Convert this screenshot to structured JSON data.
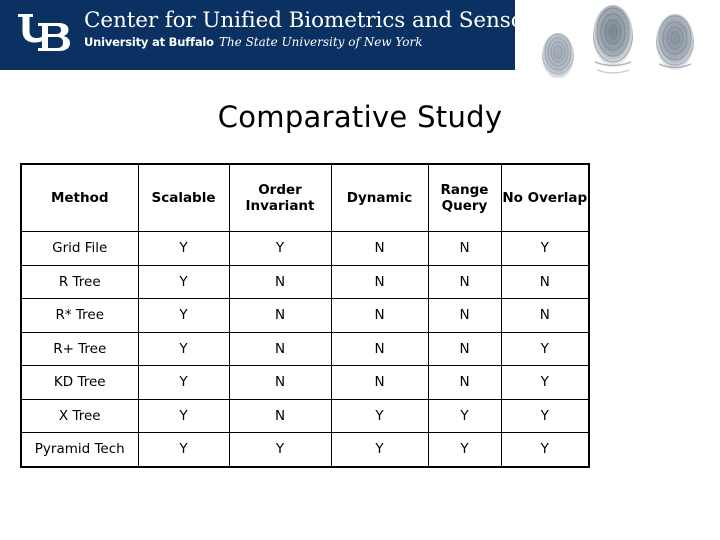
{
  "banner": {
    "logo_icon": "ub-interlocking-logo-icon",
    "org_name": "Center for Unified Biometrics and Sensors",
    "university": "University at Buffalo",
    "state_system": "The State University of New York",
    "background_color": "#0a3161",
    "text_color": "#ffffff"
  },
  "decor": {
    "fingerprint_icon": "fingerprint-icon",
    "fingerprint_count": 3
  },
  "slide": {
    "title": "Comparative Study"
  },
  "table": {
    "columns": [
      "Method",
      "Scalable",
      "Order Invariant",
      "Dynamic",
      "Range Query",
      "No Overlap"
    ],
    "rows": [
      {
        "method": "Grid File",
        "cells": [
          "Y",
          "Y",
          "N",
          "N",
          "Y"
        ],
        "highlight": false
      },
      {
        "method": "R Tree",
        "cells": [
          "Y",
          "N",
          "N",
          "N",
          "N"
        ],
        "highlight": false
      },
      {
        "method": "R* Tree",
        "cells": [
          "Y",
          "N",
          "N",
          "N",
          "N"
        ],
        "highlight": false
      },
      {
        "method": "R+ Tree",
        "cells": [
          "Y",
          "N",
          "N",
          "N",
          "Y"
        ],
        "highlight": false
      },
      {
        "method": "KD Tree",
        "cells": [
          "Y",
          "N",
          "N",
          "N",
          "Y"
        ],
        "highlight": false
      },
      {
        "method": "X Tree",
        "cells": [
          "Y",
          "N",
          "Y",
          "Y",
          "Y"
        ],
        "highlight": false
      },
      {
        "method": "Pyramid Tech",
        "cells": [
          "Y",
          "Y",
          "Y",
          "Y",
          "Y"
        ],
        "highlight": true
      }
    ]
  }
}
